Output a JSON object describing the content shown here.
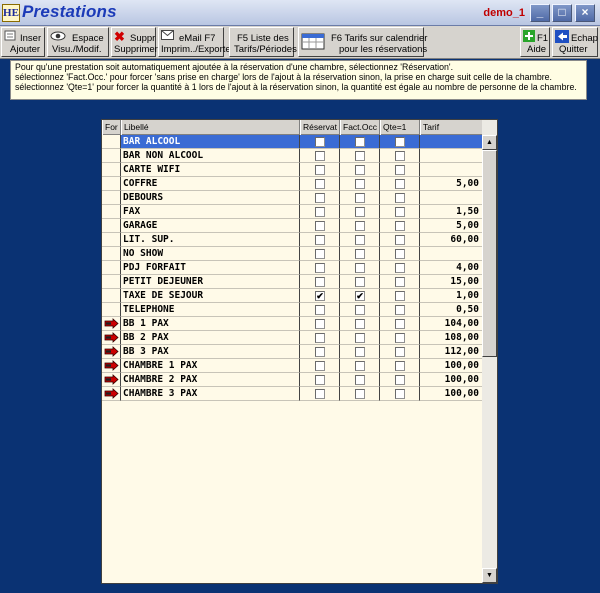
{
  "window": {
    "title": "Prestations",
    "logo": "HE",
    "user": "demo_1"
  },
  "window_controls": {
    "minimize": "_",
    "maximize": "□",
    "close": "×"
  },
  "toolbar": {
    "insert": {
      "line1": "Inser",
      "line2": "Ajouter"
    },
    "space": {
      "line1": "Espace",
      "line2": "Visu./Modif."
    },
    "delete": {
      "line1": "Suppr",
      "line2": "Supprimer"
    },
    "email": {
      "line1": "eMail  F7",
      "line2": "Imprim../Exporte"
    },
    "periods": {
      "line1": "F5  Liste des",
      "line2": "Tarifs/Périodes"
    },
    "calendar": {
      "line1": "F6 Tarifs sur calendrier",
      "line2": "pour les réservations"
    },
    "help": {
      "line1": "F1",
      "line2": "Aide"
    },
    "quit": {
      "line1": "Echap",
      "line2": "Quitter"
    }
  },
  "info": {
    "line1": "Pour qu'une prestation soit automatiquement ajoutée à la réservation d'une chambre, sélectionnez 'Réservation'.",
    "line2": "sélectionnez 'Fact.Occ.' pour forcer 'sans prise en charge' lors de l'ajout à la réservation sinon, la prise en charge suit celle de la chambre.",
    "line3": "sélectionnez 'Qte=1' pour forcer la quantité à 1 lors de l'ajout à la réservation sinon, la quantité est égale au nombre de personne  de la chambre."
  },
  "grid": {
    "columns": {
      "for": "For",
      "libelle": "Libellé",
      "reservation": "Réservat",
      "factocc": "Fact.Occ",
      "qte": "Qte=1",
      "tarif": "Tarif"
    },
    "rows": [
      {
        "libelle": "BAR ALCOOL",
        "tarif": "",
        "res": false,
        "fact": false,
        "qte": false,
        "formula": false,
        "selected": true
      },
      {
        "libelle": "BAR NON ALCOOL",
        "tarif": "",
        "res": false,
        "fact": false,
        "qte": false,
        "formula": false
      },
      {
        "libelle": "CARTE WIFI",
        "tarif": "",
        "res": false,
        "fact": false,
        "qte": false,
        "formula": false
      },
      {
        "libelle": "COFFRE",
        "tarif": "5,00",
        "res": false,
        "fact": false,
        "qte": false,
        "formula": false
      },
      {
        "libelle": "DEBOURS",
        "tarif": "",
        "res": false,
        "fact": false,
        "qte": false,
        "formula": false
      },
      {
        "libelle": "FAX",
        "tarif": "1,50",
        "res": false,
        "fact": false,
        "qte": false,
        "formula": false
      },
      {
        "libelle": "GARAGE",
        "tarif": "5,00",
        "res": false,
        "fact": false,
        "qte": false,
        "formula": false
      },
      {
        "libelle": "LIT. SUP.",
        "tarif": "60,00",
        "res": false,
        "fact": false,
        "qte": false,
        "formula": false
      },
      {
        "libelle": "NO SHOW",
        "tarif": "",
        "res": false,
        "fact": false,
        "qte": false,
        "formula": false
      },
      {
        "libelle": "PDJ FORFAIT",
        "tarif": "4,00",
        "res": false,
        "fact": false,
        "qte": false,
        "formula": false
      },
      {
        "libelle": "PETIT DEJEUNER",
        "tarif": "15,00",
        "res": false,
        "fact": false,
        "qte": false,
        "formula": false
      },
      {
        "libelle": "TAXE DE SEJOUR",
        "tarif": "1,00",
        "res": true,
        "fact": true,
        "qte": false,
        "formula": false
      },
      {
        "libelle": "TELEPHONE",
        "tarif": "0,50",
        "res": false,
        "fact": false,
        "qte": false,
        "formula": false
      },
      {
        "libelle": "BB 1 PAX",
        "tarif": "104,00",
        "res": false,
        "fact": false,
        "qte": false,
        "formula": true
      },
      {
        "libelle": "BB 2 PAX",
        "tarif": "108,00",
        "res": false,
        "fact": false,
        "qte": false,
        "formula": true
      },
      {
        "libelle": "BB 3 PAX",
        "tarif": "112,00",
        "res": false,
        "fact": false,
        "qte": false,
        "formula": true
      },
      {
        "libelle": "CHAMBRE 1 PAX",
        "tarif": "100,00",
        "res": false,
        "fact": false,
        "qte": false,
        "formula": true
      },
      {
        "libelle": "CHAMBRE 2 PAX",
        "tarif": "100,00",
        "res": false,
        "fact": false,
        "qte": false,
        "formula": true
      },
      {
        "libelle": "CHAMBRE 3 PAX",
        "tarif": "100,00",
        "res": false,
        "fact": false,
        "qte": false,
        "formula": true
      }
    ]
  },
  "icons": {
    "formula_icon": "wrench-icon",
    "check_mark": "✔",
    "scroll_up": "▲",
    "scroll_down": "▼"
  },
  "colors": {
    "background": "#0a3273",
    "selection": "#3a6bd4",
    "title_text": "#1c3bb8",
    "user_text": "#c00000",
    "grid_bg": "#fffae8"
  }
}
